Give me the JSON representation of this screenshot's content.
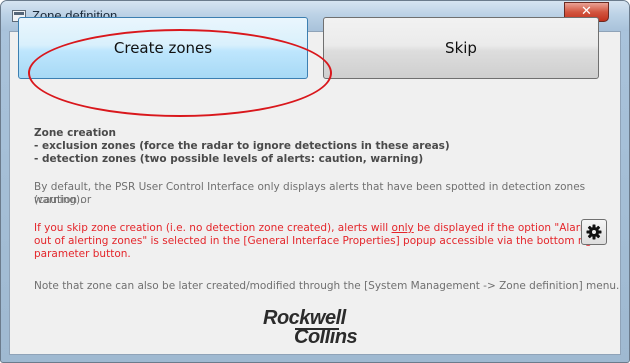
{
  "window": {
    "title": "Zone definition",
    "close_symbol": "✕"
  },
  "buttons": {
    "create_label": "Create zones",
    "skip_label": "Skip",
    "gear_icon": "gear-icon"
  },
  "zone_creation": {
    "heading": "Zone creation",
    "line1": "- exclusion zones (force the radar to ignore detections in these areas)",
    "line2": "- detection zones (two possible levels of alerts: caution, warning)"
  },
  "info": {
    "default_line1": "By default, the PSR User Control Interface only displays alerts that have been spotted in detection zones (caution or",
    "default_line2": "warning).",
    "skip_line1_a": "If you skip zone creation (i.e. no detection zone created), alerts will ",
    "skip_line1_only": "only",
    "skip_line1_b": " be displayed if the option \"Alarms",
    "skip_line2": "out of alerting zones\" is selected in the [General Interface Properties] popup accessible via the bottom right",
    "skip_line3": "parameter button.",
    "note": "Note that zone can also be later created/modified through the [System Management -> Zone definition] menu."
  },
  "logo": {
    "line1": "Rockwell",
    "line2": "Collins"
  },
  "colors": {
    "highlight_ellipse": "#d9171c",
    "warning_text": "#e4262b"
  }
}
